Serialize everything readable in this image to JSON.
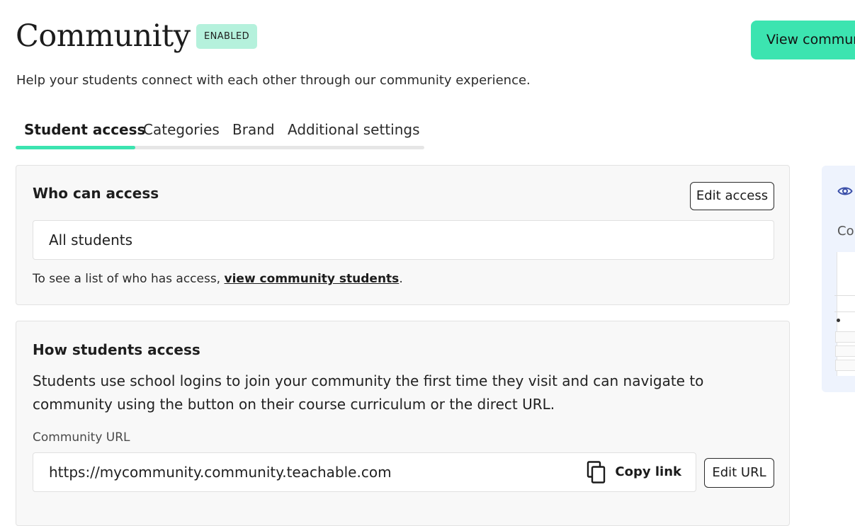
{
  "header": {
    "title": "Community",
    "status_badge": "ENABLED",
    "view_button_label": "View community",
    "subtitle": "Help your students connect with each other through our community experience."
  },
  "tabs": [
    {
      "label": "Student access",
      "active": true
    },
    {
      "label": "Categories",
      "active": false
    },
    {
      "label": "Brand",
      "active": false
    },
    {
      "label": "Additional settings",
      "active": false
    }
  ],
  "who_can_access": {
    "title": "Who can access",
    "edit_button": "Edit access",
    "value": "All students",
    "note_prefix": "To see a list of who has access, ",
    "note_link": "view community students",
    "note_suffix": "."
  },
  "how_students_access": {
    "title": "How students access",
    "description": "Students use school logins to join your community the first time they visit and can navigate to community using the button on their course curriculum or the direct URL.",
    "url_label": "Community URL",
    "url_value": "https://mycommunity.community.teachable.com",
    "copy_link_label": "Copy link",
    "edit_url_button": "Edit URL"
  },
  "preview_panel": {
    "label_partial": "Co",
    "icon": "eye-icon"
  },
  "colors": {
    "accent": "#3ce4b0",
    "badge_bg": "#b5f1dc",
    "panel_bg": "#eef3fd"
  }
}
